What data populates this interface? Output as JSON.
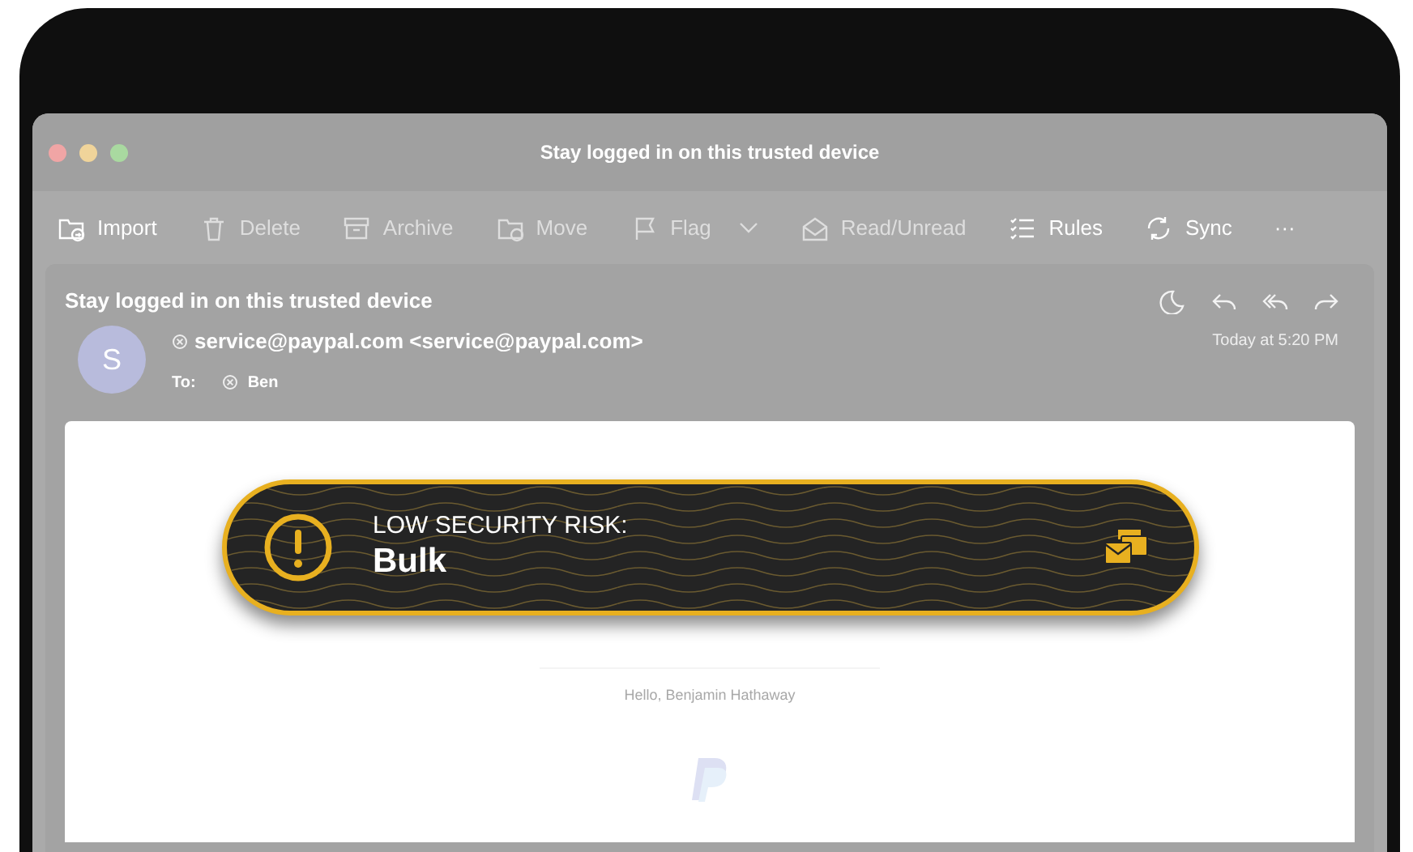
{
  "window": {
    "title": "Stay logged in on this trusted device"
  },
  "toolbar": [
    {
      "kind": "import",
      "label": "Import",
      "disabled": false
    },
    {
      "kind": "delete",
      "label": "Delete",
      "disabled": true
    },
    {
      "kind": "archive",
      "label": "Archive",
      "disabled": true
    },
    {
      "kind": "move",
      "label": "Move",
      "disabled": true
    },
    {
      "kind": "flag",
      "label": "Flag",
      "disabled": true
    },
    {
      "kind": "readunread",
      "label": "Read/Unread",
      "disabled": true
    },
    {
      "kind": "rules",
      "label": "Rules",
      "disabled": false
    },
    {
      "kind": "sync",
      "label": "Sync",
      "disabled": false
    },
    {
      "kind": "more",
      "label": "···",
      "disabled": false
    }
  ],
  "message": {
    "subject": "Stay logged in on this trusted device",
    "avatar": "S",
    "from": "service@paypal.com <service@paypal.com>",
    "to_label": "To:",
    "to": "Ben",
    "time": "Today at 5:20 PM"
  },
  "banner": {
    "title": "LOW SECURITY RISK:",
    "category": "Bulk"
  },
  "body": {
    "greeting": "Hello, Benjamin Hathaway"
  }
}
